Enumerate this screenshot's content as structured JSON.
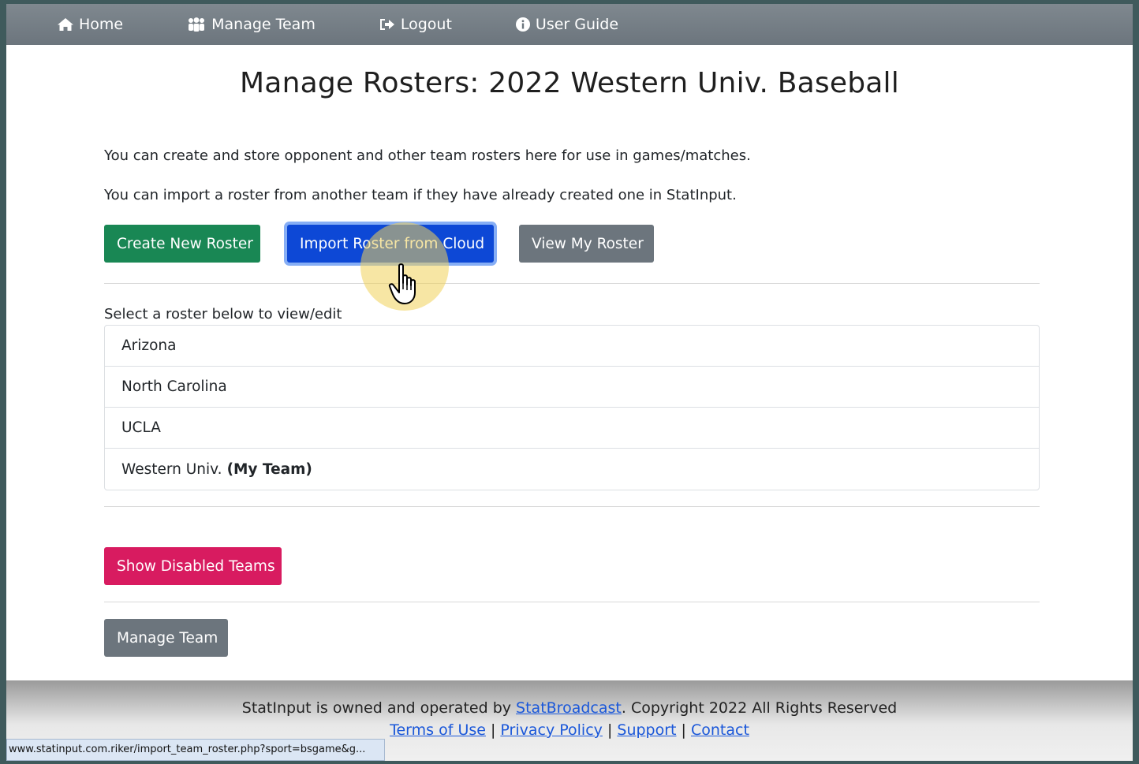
{
  "nav": {
    "home": "Home",
    "manage_team": "Manage Team",
    "logout": "Logout",
    "user_guide": "User Guide"
  },
  "page": {
    "title": "Manage Rosters: 2022 Western Univ. Baseball",
    "para1": "You can create and store opponent and other team rosters here for use in games/matches.",
    "para2": "You can import a roster from another team if they have already created one in StatInput.",
    "select_label": "Select a roster below to view/edit"
  },
  "buttons": {
    "create_new": "Create New Roster",
    "import_cloud": "Import Roster from Cloud",
    "view_my": "View My Roster",
    "show_disabled": "Show Disabled Teams",
    "manage_team": "Manage Team"
  },
  "rosters": [
    {
      "name": "Arizona",
      "tag": ""
    },
    {
      "name": "North Carolina",
      "tag": ""
    },
    {
      "name": "UCLA",
      "tag": ""
    },
    {
      "name": "Western Univ.",
      "tag": "(My Team)"
    }
  ],
  "footer": {
    "prefix": "StatInput is owned and operated by ",
    "brand_link": "StatBroadcast",
    "suffix": ". Copyright 2022 All Rights Reserved",
    "terms": "Terms of Use",
    "privacy": "Privacy Policy",
    "support": "Support",
    "contact": "Contact",
    "sep": " | "
  },
  "status_url": "www.statinput.com.riker/import_team_roster.php?sport=bsgame&g...",
  "colors": {
    "navbar": "#6c757d",
    "green": "#198754",
    "blue": "#0d48d6",
    "gray": "#6c757d",
    "pink": "#d81b60",
    "link": "#1a57d9"
  }
}
